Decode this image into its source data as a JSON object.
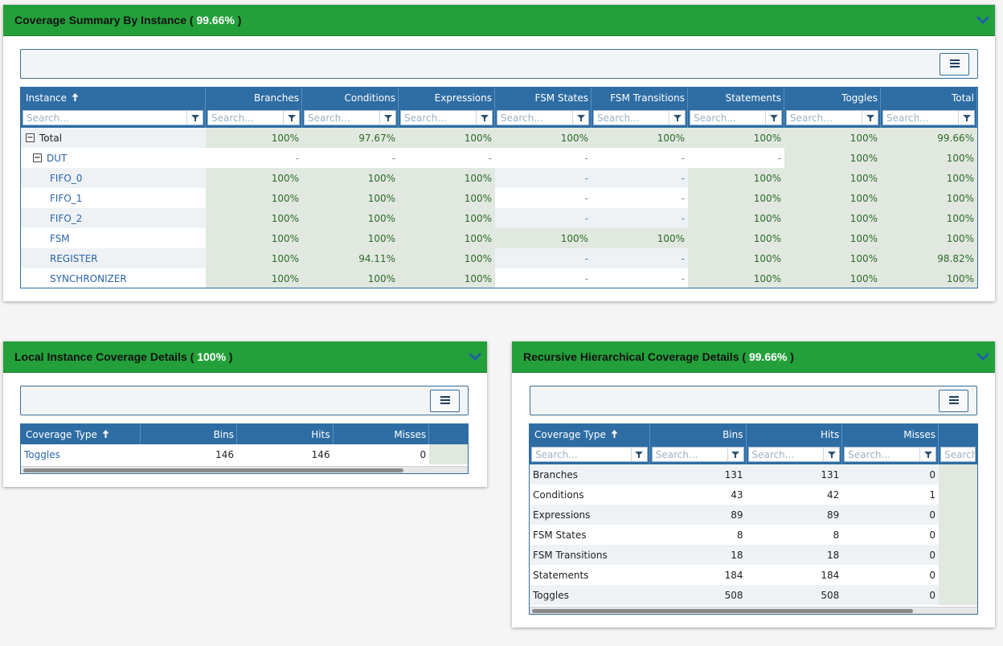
{
  "summary": {
    "title": "Coverage Summary By Instance",
    "pct": "99.66%",
    "columns": [
      "Instance",
      "Branches",
      "Conditions",
      "Expressions",
      "FSM States",
      "FSM Transitions",
      "Statements",
      "Toggles",
      "Total"
    ],
    "search_placeholder": "Search...",
    "rows": [
      {
        "name": "Total",
        "vals": [
          "100%",
          "97.67%",
          "100%",
          "100%",
          "100%",
          "100%",
          "100%",
          "99.66%"
        ]
      },
      {
        "name": "DUT",
        "vals": [
          "-",
          "-",
          "-",
          "-",
          "-",
          "-",
          "100%",
          "100%"
        ]
      },
      {
        "name": "FIFO_0",
        "vals": [
          "100%",
          "100%",
          "100%",
          "-",
          "-",
          "100%",
          "100%",
          "100%"
        ]
      },
      {
        "name": "FIFO_1",
        "vals": [
          "100%",
          "100%",
          "100%",
          "-",
          "-",
          "100%",
          "100%",
          "100%"
        ]
      },
      {
        "name": "FIFO_2",
        "vals": [
          "100%",
          "100%",
          "100%",
          "-",
          "-",
          "100%",
          "100%",
          "100%"
        ]
      },
      {
        "name": "FSM",
        "vals": [
          "100%",
          "100%",
          "100%",
          "100%",
          "100%",
          "100%",
          "100%",
          "100%"
        ]
      },
      {
        "name": "REGISTER",
        "vals": [
          "100%",
          "94.11%",
          "100%",
          "-",
          "-",
          "100%",
          "100%",
          "98.82%"
        ]
      },
      {
        "name": "SYNCHRONIZER",
        "vals": [
          "100%",
          "100%",
          "100%",
          "-",
          "-",
          "100%",
          "100%",
          "100%"
        ]
      }
    ]
  },
  "local": {
    "title": "Local Instance Coverage Details",
    "pct": "100%",
    "columns": [
      "Coverage Type",
      "Bins",
      "Hits",
      "Misses"
    ],
    "rows": [
      {
        "type": "Toggles",
        "bins": "146",
        "hits": "146",
        "misses": "0"
      }
    ]
  },
  "recursive": {
    "title": "Recursive Hierarchical Coverage Details",
    "pct": "99.66%",
    "columns": [
      "Coverage Type",
      "Bins",
      "Hits",
      "Misses"
    ],
    "search_placeholder": "Search...",
    "rows": [
      {
        "type": "Branches",
        "bins": "131",
        "hits": "131",
        "misses": "0"
      },
      {
        "type": "Conditions",
        "bins": "43",
        "hits": "42",
        "misses": "1"
      },
      {
        "type": "Expressions",
        "bins": "89",
        "hits": "89",
        "misses": "0"
      },
      {
        "type": "FSM States",
        "bins": "8",
        "hits": "8",
        "misses": "0"
      },
      {
        "type": "FSM Transitions",
        "bins": "18",
        "hits": "18",
        "misses": "0"
      },
      {
        "type": "Statements",
        "bins": "184",
        "hits": "184",
        "misses": "0"
      },
      {
        "type": "Toggles",
        "bins": "508",
        "hits": "508",
        "misses": "0"
      }
    ]
  },
  "colors": {
    "header_green": "#23a03a",
    "grid_blue": "#2e6da4",
    "covered_bg": "#e1e8df",
    "covered_text": "#2d6a2d",
    "link_blue": "#2a64a8"
  },
  "icons": {
    "collapse": "chevron-down-icon",
    "menu": "hamburger-menu-icon",
    "filter": "filter-icon",
    "sort": "sort-ascending-icon",
    "tree": "tree-collapse-icon"
  }
}
